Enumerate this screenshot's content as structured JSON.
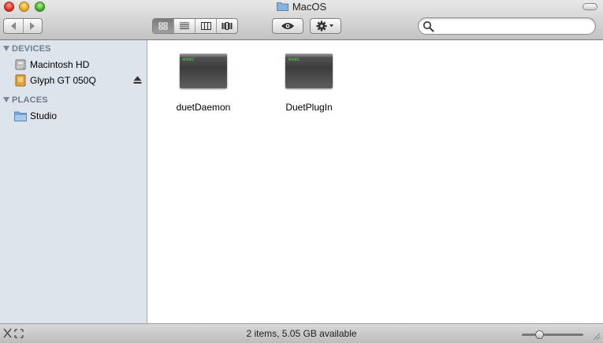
{
  "window": {
    "title": "MacOS",
    "title_icon": "folder-icon"
  },
  "toolbar": {
    "back_icon": "chevron-left-icon",
    "forward_icon": "chevron-right-icon",
    "view_buttons": [
      "icon-view-icon",
      "list-view-icon",
      "column-view-icon",
      "coverflow-view-icon"
    ],
    "active_view": "icon-view",
    "quick_look_icon": "eye-icon",
    "action_icon": "gear-icon",
    "search": {
      "value": "",
      "placeholder": ""
    }
  },
  "sidebar": {
    "sections": [
      {
        "heading": "DEVICES",
        "items": [
          {
            "label": "Macintosh HD",
            "icon": "hard-drive-icon"
          },
          {
            "label": "Glyph GT 050Q",
            "icon": "external-drive-icon",
            "ejectable": true
          }
        ]
      },
      {
        "heading": "PLACES",
        "items": [
          {
            "label": "Studio",
            "icon": "folder-icon"
          }
        ]
      }
    ]
  },
  "files": [
    {
      "name": "duetDaemon",
      "icon": "unix-executable-icon",
      "badge": "exec"
    },
    {
      "name": "DuetPlugIn",
      "icon": "unix-executable-icon",
      "badge": "exec"
    }
  ],
  "status": {
    "text": "2 items, 5.05 GB available",
    "zoom_level": 0.25
  },
  "colors": {
    "sidebar_bg": "#dde4ec",
    "section_heading": "#6e7d8e",
    "exec_text": "#5bd35b"
  }
}
